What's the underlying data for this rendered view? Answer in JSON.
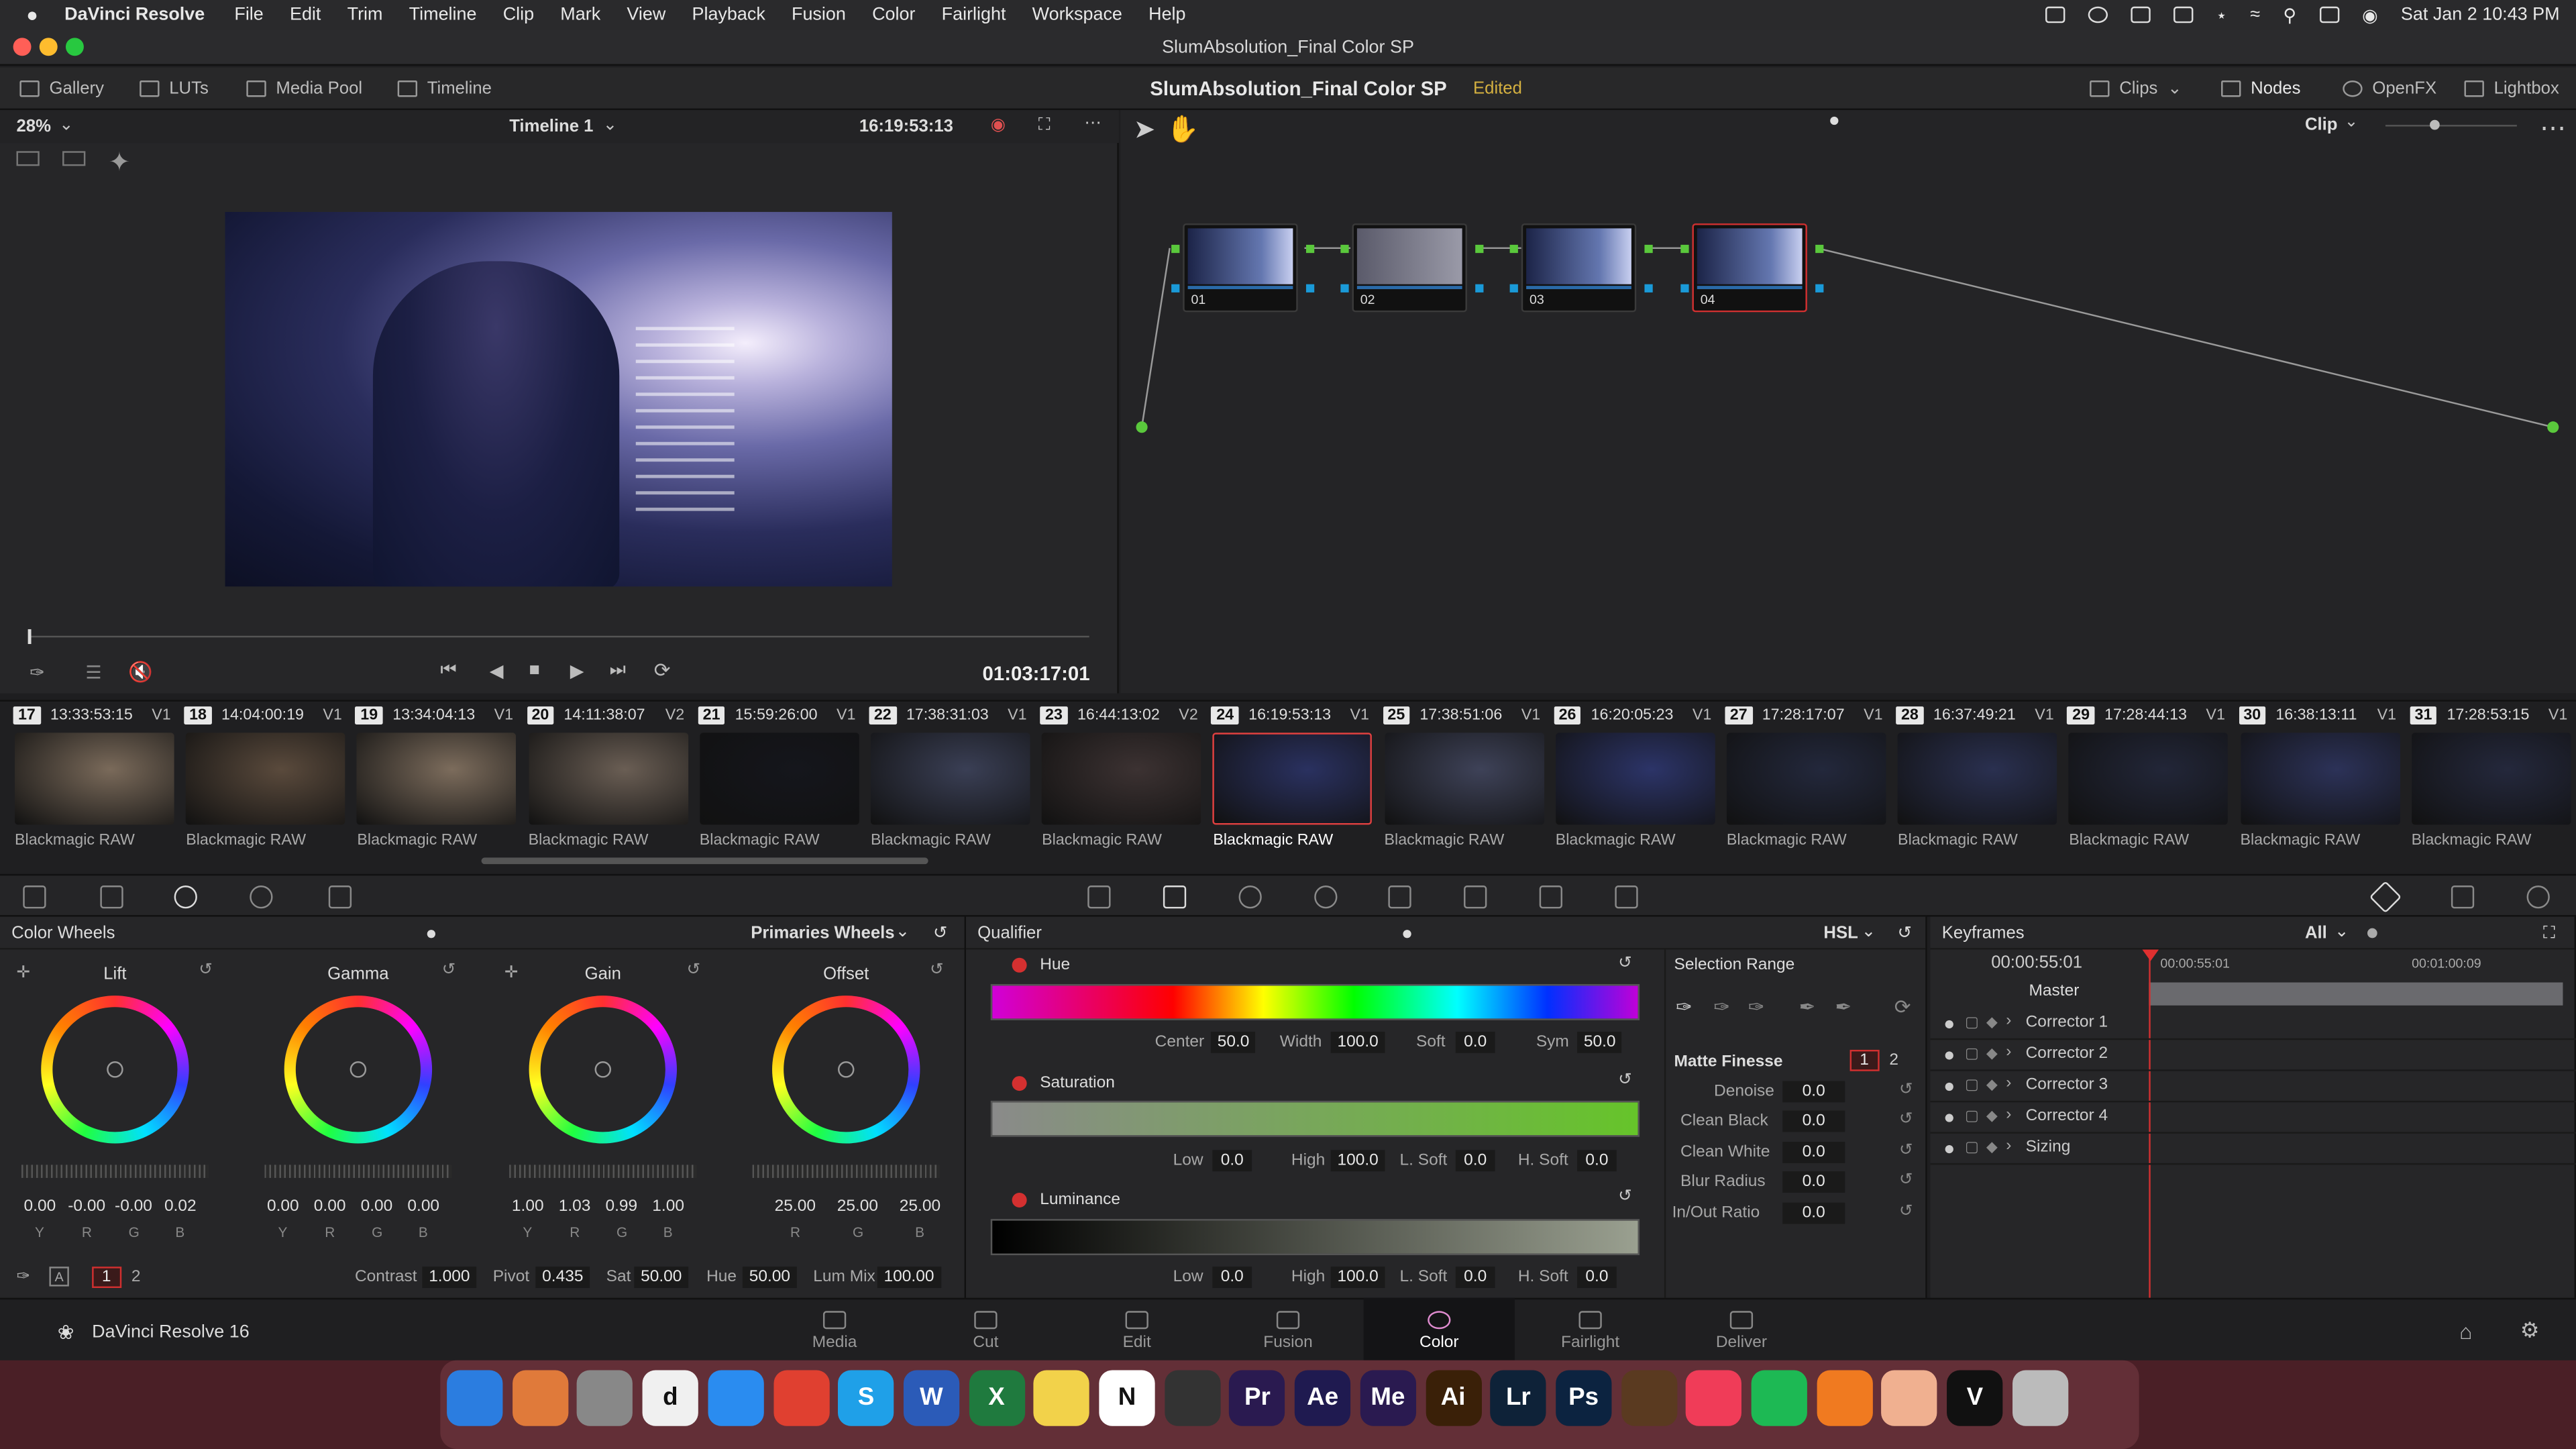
{
  "menubar": {
    "apple": "",
    "app": "DaVinci Resolve",
    "items": [
      "File",
      "Edit",
      "Trim",
      "Timeline",
      "Clip",
      "Mark",
      "View",
      "Playback",
      "Fusion",
      "Color",
      "Fairlight",
      "Workspace",
      "Help"
    ],
    "datetime": "Sat Jan 2  10:43 PM"
  },
  "window": {
    "title": "SlumAbsolution_Final Color SP"
  },
  "toolbar": {
    "gallery": "Gallery",
    "luts": "LUTs",
    "media_pool": "Media Pool",
    "timeline": "Timeline",
    "project": "SlumAbsolution_Final Color SP",
    "status": "Edited",
    "clips": "Clips",
    "nodes": "Nodes",
    "openfx": "OpenFX",
    "lightbox": "Lightbox"
  },
  "viewer": {
    "zoom": "28%",
    "timeline_name": "Timeline 1",
    "tc": "16:19:53:13",
    "playhead_tc": "01:03:17:01"
  },
  "nodes": {
    "mode": "Clip",
    "list": [
      {
        "id": "01"
      },
      {
        "id": "02"
      },
      {
        "id": "03"
      },
      {
        "id": "04"
      }
    ]
  },
  "clips": [
    {
      "n": "17",
      "tc": "13:33:53:15",
      "trk": "V1",
      "cap": "Blackmagic RAW",
      "c": "#7a6a5a"
    },
    {
      "n": "18",
      "tc": "14:04:00:19",
      "trk": "V1",
      "cap": "Blackmagic RAW",
      "c": "#5a4a3c"
    },
    {
      "n": "19",
      "tc": "13:34:04:13",
      "trk": "V1",
      "cap": "Blackmagic RAW",
      "c": "#7c6c5c"
    },
    {
      "n": "20",
      "tc": "14:11:38:07",
      "trk": "V2",
      "cap": "Blackmagic RAW",
      "c": "#6a5e54"
    },
    {
      "n": "21",
      "tc": "15:59:26:00",
      "trk": "V1",
      "cap": "Blackmagic RAW",
      "c": "#15161c"
    },
    {
      "n": "22",
      "tc": "17:38:31:03",
      "trk": "V1",
      "cap": "Blackmagic RAW",
      "c": "#3a3f55"
    },
    {
      "n": "23",
      "tc": "16:44:13:02",
      "trk": "V2",
      "cap": "Blackmagic RAW",
      "c": "#3c3232"
    },
    {
      "n": "24",
      "tc": "16:19:53:13",
      "trk": "V1",
      "cap": "Blackmagic RAW",
      "c": "#2a3160"
    },
    {
      "n": "25",
      "tc": "17:38:51:06",
      "trk": "V1",
      "cap": "Blackmagic RAW",
      "c": "#3e4258"
    },
    {
      "n": "26",
      "tc": "16:20:05:23",
      "trk": "V1",
      "cap": "Blackmagic RAW",
      "c": "#2c3468"
    },
    {
      "n": "27",
      "tc": "17:28:17:07",
      "trk": "V1",
      "cap": "Blackmagic RAW",
      "c": "#23283c"
    },
    {
      "n": "28",
      "tc": "16:37:49:21",
      "trk": "V1",
      "cap": "Blackmagic RAW",
      "c": "#2a3050"
    },
    {
      "n": "29",
      "tc": "17:28:44:13",
      "trk": "V1",
      "cap": "Blackmagic RAW",
      "c": "#222638"
    },
    {
      "n": "30",
      "tc": "16:38:13:11",
      "trk": "V1",
      "cap": "Blackmagic RAW",
      "c": "#2c3258"
    },
    {
      "n": "31",
      "tc": "17:28:53:15",
      "trk": "V1",
      "cap": "Blackmagic RAW",
      "c": "#24283c"
    }
  ],
  "colorwheels": {
    "title": "Color Wheels",
    "mode": "Primaries Wheels",
    "lift": {
      "label": "Lift",
      "vals": [
        "0.00",
        "-0.00",
        "-0.00",
        "0.02"
      ],
      "ch": [
        "Y",
        "R",
        "G",
        "B"
      ]
    },
    "gamma": {
      "label": "Gamma",
      "vals": [
        "0.00",
        "0.00",
        "0.00",
        "0.00"
      ],
      "ch": [
        "Y",
        "R",
        "G",
        "B"
      ]
    },
    "gain": {
      "label": "Gain",
      "vals": [
        "1.00",
        "1.03",
        "0.99",
        "1.00"
      ],
      "ch": [
        "Y",
        "R",
        "G",
        "B"
      ]
    },
    "offset": {
      "label": "Offset",
      "vals": [
        "25.00",
        "25.00",
        "25.00"
      ],
      "ch": [
        "R",
        "G",
        "B"
      ]
    },
    "page1": "1",
    "page2": "2",
    "contrast_lbl": "Contrast",
    "contrast": "1.000",
    "pivot_lbl": "Pivot",
    "pivot": "0.435",
    "sat_lbl": "Sat",
    "sat": "50.00",
    "hue_lbl": "Hue",
    "hue": "50.00",
    "lummix_lbl": "Lum Mix",
    "lummix": "100.00"
  },
  "qualifier": {
    "title": "Qualifier",
    "mode": "HSL",
    "hue_lbl": "Hue",
    "center_lbl": "Center",
    "center": "50.0",
    "width_lbl": "Width",
    "width": "100.0",
    "soft_lbl": "Soft",
    "soft": "0.0",
    "sym_lbl": "Sym",
    "sym": "50.0",
    "sat_lbl": "Saturation",
    "low_lbl": "Low",
    "sat_low": "0.0",
    "high_lbl": "High",
    "sat_high": "100.0",
    "lsoft_lbl": "L. Soft",
    "sat_lsoft": "0.0",
    "hsoft_lbl": "H. Soft",
    "sat_hsoft": "0.0",
    "lum_lbl": "Luminance",
    "lum_low": "0.0",
    "lum_high": "100.0",
    "lum_lsoft": "0.0",
    "lum_hsoft": "0.0",
    "selection_range": "Selection Range",
    "matte_finesse": "Matte Finesse",
    "mf1": "1",
    "mf2": "2",
    "matte": [
      {
        "l": "Denoise",
        "v": "0.0"
      },
      {
        "l": "Clean Black",
        "v": "0.0"
      },
      {
        "l": "Clean White",
        "v": "0.0"
      },
      {
        "l": "Blur Radius",
        "v": "0.0"
      },
      {
        "l": "In/Out Ratio",
        "v": "0.0"
      }
    ]
  },
  "keyframes": {
    "title": "Keyframes",
    "filter": "All",
    "tc": "00:00:55:01",
    "t0": "00:00:55:01",
    "t1": "00:01:00:09",
    "master": "Master",
    "rows": [
      "Corrector 1",
      "Corrector 2",
      "Corrector 3",
      "Corrector 4",
      "Sizing"
    ]
  },
  "pages": [
    {
      "l": "Media"
    },
    {
      "l": "Cut"
    },
    {
      "l": "Edit"
    },
    {
      "l": "Fusion"
    },
    {
      "l": "Color",
      "active": true
    },
    {
      "l": "Fairlight"
    },
    {
      "l": "Deliver"
    }
  ],
  "brand": "DaVinci Resolve 16",
  "dock": [
    {
      "l": "",
      "c": "#2b7de0"
    },
    {
      "l": "",
      "c": "#e07a3a"
    },
    {
      "l": "",
      "c": "#888"
    },
    {
      "l": "d",
      "c": "#f0f0f0"
    },
    {
      "l": "",
      "c": "#2a8cf0"
    },
    {
      "l": "",
      "c": "#e04030"
    },
    {
      "l": "S",
      "c": "#1fa0e8"
    },
    {
      "l": "W",
      "c": "#2b5bb8"
    },
    {
      "l": "X",
      "c": "#1f7a3e"
    },
    {
      "l": "",
      "c": "#f2d24a"
    },
    {
      "l": "N",
      "c": "#ffffff"
    },
    {
      "l": "",
      "c": "#333"
    },
    {
      "l": "Pr",
      "c": "#2a1a50"
    },
    {
      "l": "Ae",
      "c": "#1f1a50"
    },
    {
      "l": "Me",
      "c": "#2a1a50"
    },
    {
      "l": "Ai",
      "c": "#3a2008"
    },
    {
      "l": "Lr",
      "c": "#0e2238"
    },
    {
      "l": "Ps",
      "c": "#0c2340"
    },
    {
      "l": "",
      "c": "#5a3a20"
    },
    {
      "l": "",
      "c": "#f03c58"
    },
    {
      "l": "",
      "c": "#1db954"
    },
    {
      "l": "",
      "c": "#f07a20"
    },
    {
      "l": "",
      "c": "#f0b090"
    },
    {
      "l": "V",
      "c": "#111"
    },
    {
      "l": "",
      "c": "#bbb"
    }
  ]
}
